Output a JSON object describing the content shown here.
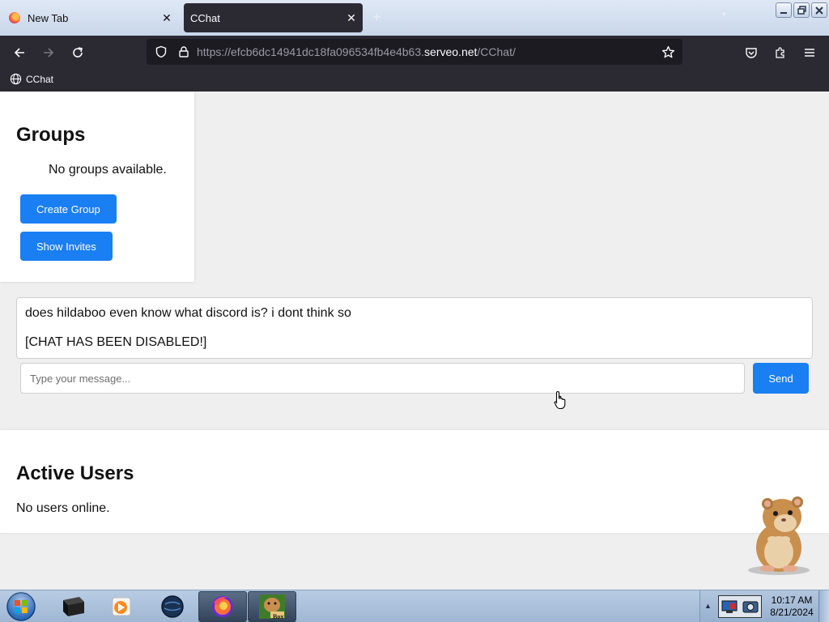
{
  "browser": {
    "tabs": [
      {
        "label": "New Tab",
        "active": false
      },
      {
        "label": "CChat",
        "active": true
      }
    ],
    "url": {
      "prefix": "https://efcb6dc14941dc18fa096534fb4e4b63.",
      "host": "serveo.net",
      "path": "/CChat/"
    },
    "bookmarks": [
      {
        "label": "CChat"
      }
    ]
  },
  "groups": {
    "title": "Groups",
    "empty_text": "No groups available.",
    "create_label": "Create Group",
    "invites_label": "Show Invites"
  },
  "chat": {
    "messages": [
      "does hildaboo even know what discord is? i dont think so",
      "[CHAT HAS BEEN DISABLED!]"
    ],
    "input_placeholder": "Type your message...",
    "send_label": "Send"
  },
  "users": {
    "title": "Active Users",
    "empty_text": "No users online."
  },
  "taskbar": {
    "time": "10:17 AM",
    "date": "8/21/2024",
    "box_label": "Box"
  },
  "colors": {
    "accent": "#1a7ff3",
    "browser_chrome": "#2b2a33",
    "page_bg": "#efefef"
  }
}
